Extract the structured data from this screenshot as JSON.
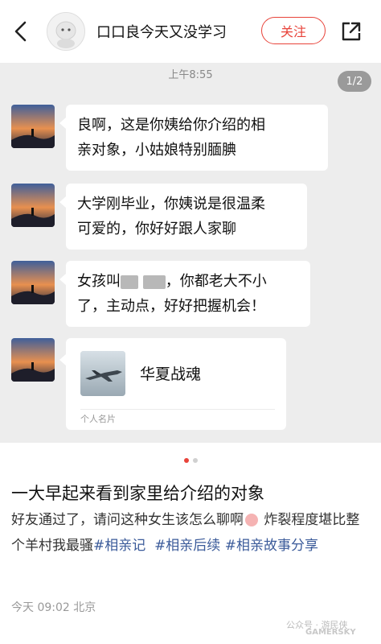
{
  "header": {
    "title": "口口良今天又没学习",
    "follow_label": "关注"
  },
  "chat": {
    "time": "上午8:55",
    "page_indicator": "1/2",
    "messages": [
      {
        "line1": "良啊，这是你姨给你介绍的相",
        "line2": "亲对象，小姑娘特别腼腆"
      },
      {
        "line1": "大学刚毕业，你姨说是很温柔",
        "line2": "可爱的，你好好跟人家聊"
      },
      {
        "line1_pre": "女孩叫",
        "line1_post": "，你都老大不小",
        "line2": "了，主动点，好好把握机会！"
      }
    ],
    "card": {
      "name": "华夏战魂",
      "label": "个人名片"
    }
  },
  "post": {
    "title": "一大早起来看到家里给介绍的对象",
    "body_1": "好友通过了，请问这种女生该怎么聊啊",
    "body_2": " 炸裂程度堪比整个羊村我最骚",
    "tags": [
      "#相亲记",
      "#相亲后续",
      "#相亲故事分享"
    ],
    "meta": "今天 09:02 北京"
  },
  "watermark": {
    "text": "公众号 · 游民侠",
    "brand": "GAMERSKY"
  },
  "colors": {
    "accent": "#e8433a",
    "tag": "#3b5b9a",
    "chat_bg": "#ededed"
  }
}
